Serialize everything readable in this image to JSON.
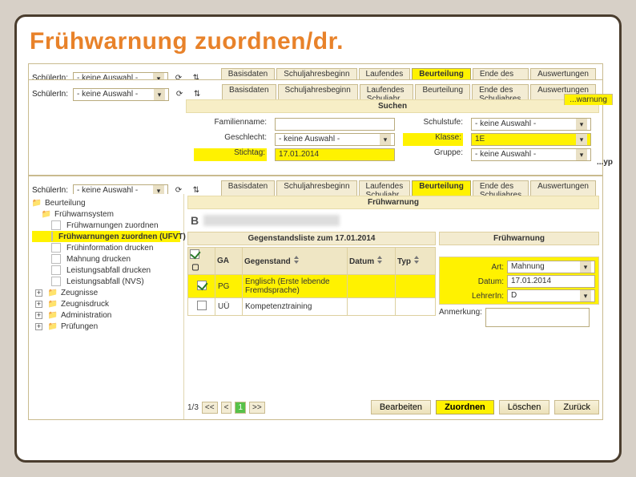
{
  "page_title": "Frühwarnung zuordnen/dr.",
  "schuelerIn_label": "SchülerIn:",
  "schulerIn_label": "SchülerIn:",
  "no_selection": "- keine Auswahl -",
  "tabs": [
    "Basisdaten",
    "Schuljahresbeginn",
    "Laufendes Schuljahr",
    "Beurteilung",
    "Ende des Schuljahres",
    "Auswertungen"
  ],
  "tree1": {
    "root": "Beurteilung",
    "node": "Frühwarnsystem",
    "items": [
      "Frühwarnungen zuordnen",
      "Frühwarnungen zuordnen (UFVT)",
      "Frühinformation drucken",
      "Mahnung drucken",
      "Leistungsabfall drucken"
    ],
    "selected_index": 1
  },
  "tree2": {
    "root": "Beurteilung",
    "node": "Frühwarnsystem",
    "items": [
      "Frühwarnungen zuordnen",
      "Frühwarnungen zuordnen (UFVT)",
      "Frühinformation drucken",
      "Mahnung drucken",
      "Leistungsabfall drucken",
      "Leistungsabfall (NVS)"
    ],
    "selected_index": 1,
    "extras": [
      "Zeugnisse",
      "Zeugnisdruck",
      "Administration",
      "Prüfungen"
    ]
  },
  "search": {
    "header": "Suchen",
    "familienname": "Familienname:",
    "schulstufe": "Schulstufe:",
    "geschlecht": "Geschlecht:",
    "klasse": "Klasse:",
    "stichtag": "Stichtag:",
    "gruppe": "Gruppe:",
    "stichtag_val": "17.01.2014",
    "klasse_val": "1E",
    "gruppe_val": "- keine Auswahl -",
    "geschlecht_val": "- keine Auswahl -",
    "schulstufe_val": "- keine Auswahl -"
  },
  "fruehwarnung": {
    "header": "Frühwarnung",
    "list_title": "Gegenstandsliste zum 17.01.2014",
    "side_title": "Frühwarnung",
    "cols": [
      "",
      "GA",
      "Gegenstand",
      "Datum",
      "Typ"
    ],
    "rows": [
      {
        "sel": true,
        "ga": "PG",
        "name": "Englisch (Erste lebende Fremdsprache)"
      },
      {
        "sel": false,
        "ga": "UÜ",
        "name": "Kompetenztraining"
      }
    ],
    "form": {
      "art": "Art:",
      "art_val": "Mahnung",
      "datum": "Datum:",
      "datum_val": "17.01.2014",
      "lehrerin": "LehrerIn:",
      "lehrerin_val": "D",
      "anmerkung": "Anmerkung:"
    }
  },
  "pager": {
    "pages": "1/3",
    "prev2": "<<",
    "prev": "<",
    "cur": "1",
    "next": ">>"
  },
  "footer": {
    "bearbeiten": "Bearbeiten",
    "zuordnen": "Zuordnen",
    "loeschen": "Löschen",
    "zurueck": "Zurück"
  },
  "tabs_extra": {
    "warn_tab": "...warnung",
    "yp_tab": "...yp"
  }
}
